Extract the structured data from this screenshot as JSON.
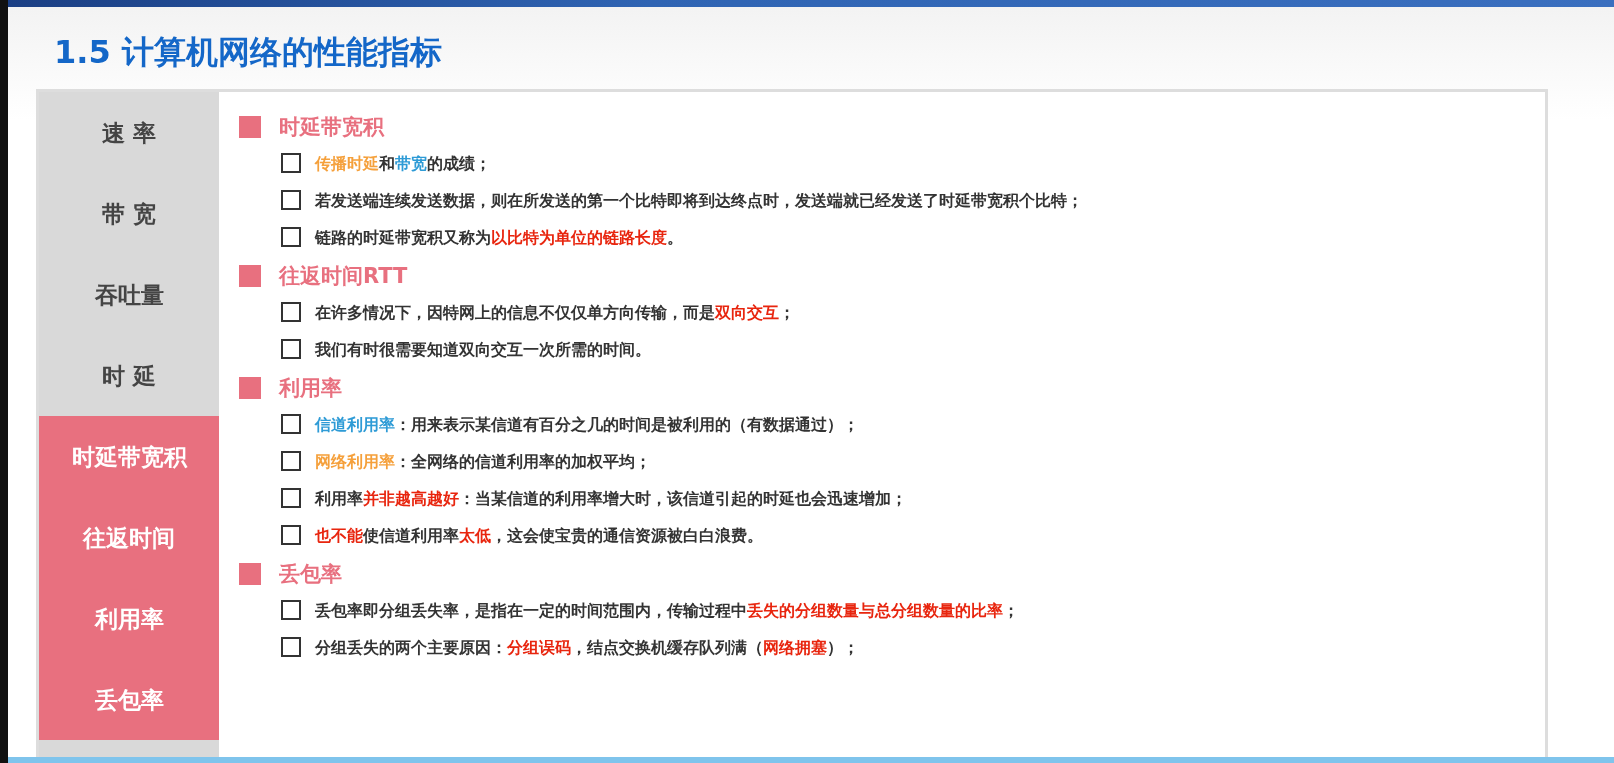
{
  "title": "1.5 计算机网络的性能指标",
  "sidebar": {
    "items": [
      {
        "label": "速 率",
        "highlighted": false
      },
      {
        "label": "带 宽",
        "highlighted": false
      },
      {
        "label": "吞吐量",
        "highlighted": false
      },
      {
        "label": "时 延",
        "highlighted": false
      },
      {
        "label": "时延带宽积",
        "highlighted": true
      },
      {
        "label": "往返时间",
        "highlighted": true
      },
      {
        "label": "利用率",
        "highlighted": true
      },
      {
        "label": "丢包率",
        "highlighted": true
      }
    ]
  },
  "sections": [
    {
      "heading": "时延带宽积",
      "points": [
        [
          {
            "text": "传播时延",
            "kind": "orange"
          },
          {
            "text": "和",
            "kind": "plain"
          },
          {
            "text": "带宽",
            "kind": "blue"
          },
          {
            "text": "的成绩；",
            "kind": "plain"
          }
        ],
        [
          {
            "text": "若发送端连续发送数据，则在所发送的第一个比特即将到达终点时，发送端就已经发送了时延带宽积个比特；",
            "kind": "plain"
          }
        ],
        [
          {
            "text": "链路的时延带宽积又称为",
            "kind": "plain"
          },
          {
            "text": "以比特为单位的链路长度",
            "kind": "red"
          },
          {
            "text": "。",
            "kind": "plain"
          }
        ]
      ]
    },
    {
      "heading": "往返时间RTT",
      "points": [
        [
          {
            "text": "在许多情况下，因特网上的信息不仅仅单方向传输，而是",
            "kind": "plain"
          },
          {
            "text": "双向交互",
            "kind": "red"
          },
          {
            "text": "；",
            "kind": "plain"
          }
        ],
        [
          {
            "text": "我们有时很需要知道双向交互一次所需的时间。",
            "kind": "plain"
          }
        ]
      ]
    },
    {
      "heading": "利用率",
      "points": [
        [
          {
            "text": "信道利用率",
            "kind": "blue"
          },
          {
            "text": "：用来表示某信道有百分之几的时间是被利用的（有数据通过）；",
            "kind": "plain"
          }
        ],
        [
          {
            "text": "网络利用率",
            "kind": "orange"
          },
          {
            "text": "：全网络的信道利用率的加权平均；",
            "kind": "plain"
          }
        ],
        [
          {
            "text": "利用率",
            "kind": "plain"
          },
          {
            "text": "并非越高越好",
            "kind": "red"
          },
          {
            "text": "：当某信道的利用率增大时，该信道引起的时延也会迅速增加；",
            "kind": "plain"
          }
        ],
        [
          {
            "text": "也不能",
            "kind": "red"
          },
          {
            "text": "使信道利用率",
            "kind": "plain"
          },
          {
            "text": "太低",
            "kind": "red"
          },
          {
            "text": "，这会使宝贵的通信资源被白白浪费。",
            "kind": "plain"
          }
        ]
      ]
    },
    {
      "heading": "丢包率",
      "points": [
        [
          {
            "text": "丢包率即分组丢失率，是指在一定的时间范围内，传输过程中",
            "kind": "plain"
          },
          {
            "text": "丢失的分组数量与总分组数量的比率",
            "kind": "red"
          },
          {
            "text": "；",
            "kind": "plain"
          }
        ],
        [
          {
            "text": "分组丢失的两个主要原因：",
            "kind": "plain"
          },
          {
            "text": "分组误码",
            "kind": "red"
          },
          {
            "text": "，结点交换机缓存队列满（",
            "kind": "plain"
          },
          {
            "text": "网络拥塞",
            "kind": "red"
          },
          {
            "text": "）；",
            "kind": "plain"
          }
        ]
      ]
    }
  ]
}
